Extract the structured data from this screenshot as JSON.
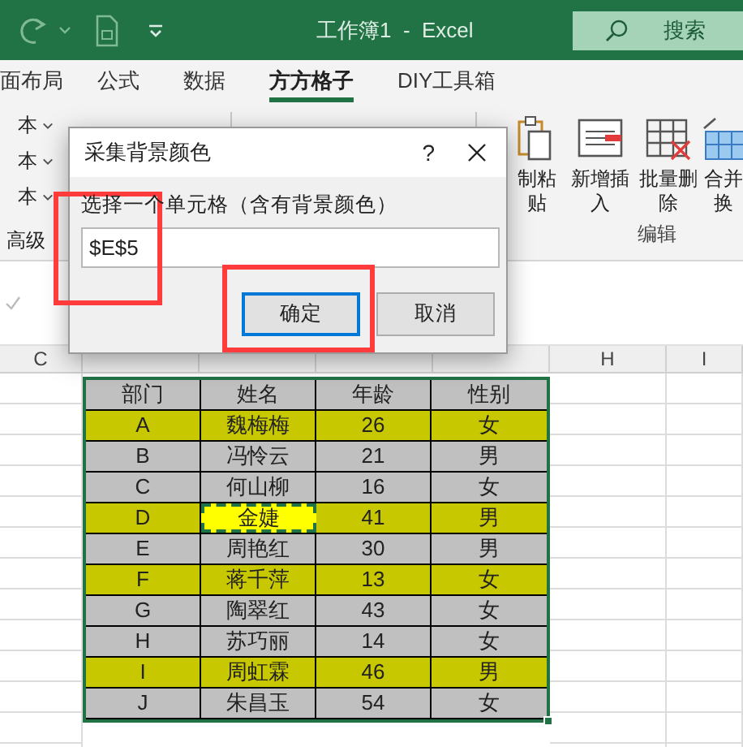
{
  "window": {
    "title": "工作簿1  -  Excel",
    "search": "搜索"
  },
  "tabs": [
    {
      "label": "面布局",
      "selected": false
    },
    {
      "label": "公式",
      "selected": false
    },
    {
      "label": "数据",
      "selected": false
    },
    {
      "label": "方方格子",
      "selected": true
    },
    {
      "label": "DIY工具箱",
      "selected": false
    }
  ],
  "ribbon": {
    "left_items": [
      "本",
      "本",
      "本"
    ],
    "left_group": "高级",
    "right_buttons": [
      {
        "kind": "clipboard",
        "lines": [
          "制粘",
          "贴"
        ]
      },
      {
        "kind": "insert",
        "lines": [
          "新增插",
          "入"
        ]
      },
      {
        "kind": "delete",
        "lines": [
          "批量删",
          "除"
        ]
      },
      {
        "kind": "merge",
        "lines": [
          "合并",
          "换"
        ]
      }
    ],
    "right_group": "编辑"
  },
  "columns_left": [
    "C"
  ],
  "columns_right": [
    "H",
    "I"
  ],
  "table": {
    "header": [
      "部门",
      "姓名",
      "年龄",
      "性别"
    ],
    "rows": [
      {
        "cells": [
          "A",
          "魏梅梅",
          "26",
          "女"
        ],
        "color": "#c8c800",
        "picked": false
      },
      {
        "cells": [
          "B",
          "冯怜云",
          "21",
          "男"
        ],
        "color": "#c0c0c0",
        "picked": false
      },
      {
        "cells": [
          "C",
          "何山柳",
          "16",
          "女"
        ],
        "color": "#c0c0c0",
        "picked": false
      },
      {
        "cells": [
          "D",
          "金婕",
          "41",
          "男"
        ],
        "color": "#c8c800",
        "picked": true
      },
      {
        "cells": [
          "E",
          "周艳红",
          "30",
          "男"
        ],
        "color": "#c0c0c0",
        "picked": false
      },
      {
        "cells": [
          "F",
          "蒋千萍",
          "13",
          "女"
        ],
        "color": "#c8c800",
        "picked": false
      },
      {
        "cells": [
          "G",
          "陶翠红",
          "43",
          "女"
        ],
        "color": "#c0c0c0",
        "picked": false
      },
      {
        "cells": [
          "H",
          "苏巧丽",
          "14",
          "女"
        ],
        "color": "#c0c0c0",
        "picked": false
      },
      {
        "cells": [
          "I",
          "周虹霖",
          "46",
          "男"
        ],
        "color": "#c8c800",
        "picked": false
      },
      {
        "cells": [
          "J",
          "朱昌玉",
          "54",
          "女"
        ],
        "color": "#c0c0c0",
        "picked": false
      }
    ]
  },
  "dialog": {
    "title": "采集背景颜色",
    "help": "?",
    "label": "选择一个单元格（含有背景颜色）",
    "value": "$E$5",
    "buttons": [
      {
        "label": "确定",
        "focused": true
      },
      {
        "label": "取消",
        "focused": false
      }
    ]
  }
}
